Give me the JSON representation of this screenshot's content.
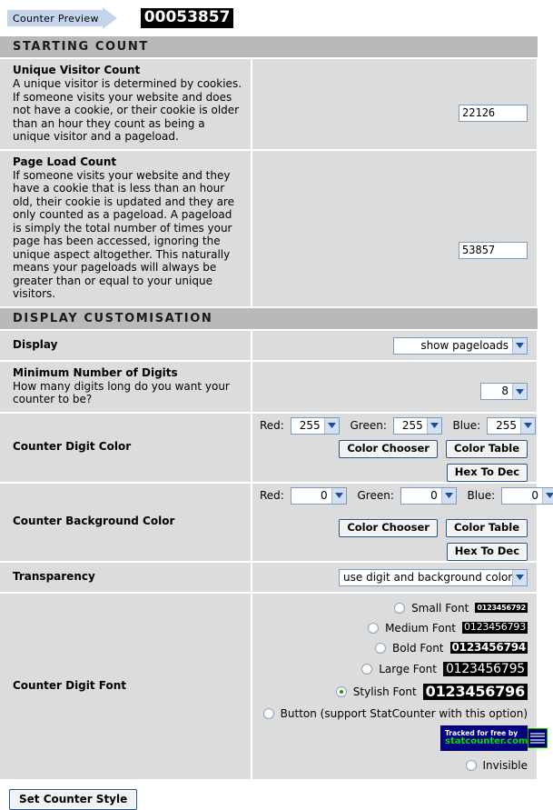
{
  "preview": {
    "label": "Counter Preview",
    "counter_value": "00053857"
  },
  "sections": {
    "starting_count": {
      "heading": "STARTING COUNT",
      "unique_visitor": {
        "title": "Unique Visitor Count",
        "description": "A unique visitor is determined by cookies. If someone visits your website and does not have a cookie, or their cookie is older than an hour they count as being a unique visitor and a pageload.",
        "value": "22126"
      },
      "page_load": {
        "title": "Page Load Count",
        "description": "If someone visits your website and they have a cookie that is less than an hour old, their cookie is updated and they are only counted as a pageload. A pageload is simply the total number of times your page has been accessed, ignoring the unique aspect altogether. This naturally means your pageloads will always be greater than or equal to your unique visitors.",
        "value": "53857"
      }
    },
    "display_customisation": {
      "heading": "DISPLAY CUSTOMISATION",
      "display": {
        "label": "Display",
        "selected": "show pageloads"
      },
      "min_digits": {
        "title": "Minimum Number of Digits",
        "description": "How many digits long do you want your counter to be?",
        "selected": "8"
      },
      "digit_color": {
        "label": "Counter Digit Color",
        "red_label": "Red:",
        "green_label": "Green:",
        "blue_label": "Blue:",
        "red": "255",
        "green": "255",
        "blue": "255",
        "btn_color_chooser": "Color Chooser",
        "btn_color_table": "Color Table",
        "btn_hex_to_dec": "Hex To Dec"
      },
      "background_color": {
        "label": "Counter Background Color",
        "red_label": "Red:",
        "green_label": "Green:",
        "blue_label": "Blue:",
        "red": "0",
        "green": "0",
        "blue": "0",
        "btn_color_chooser": "Color Chooser",
        "btn_color_table": "Color Table",
        "btn_hex_to_dec": "Hex To Dec"
      },
      "transparency": {
        "label": "Transparency",
        "selected": "use digit and background color"
      },
      "digit_font": {
        "label": "Counter Digit Font",
        "options": [
          {
            "label": "Small Font",
            "sample": "0123456792",
            "selected": false
          },
          {
            "label": "Medium Font",
            "sample": "0123456793",
            "selected": false
          },
          {
            "label": "Bold Font",
            "sample": "0123456794",
            "selected": false
          },
          {
            "label": "Large Font",
            "sample": "0123456795",
            "selected": false
          },
          {
            "label": "Stylish Font",
            "sample": "0123456796",
            "selected": true
          },
          {
            "label": "Button (support StatCounter with this option)",
            "sample": "",
            "selected": false
          },
          {
            "label": "Invisible",
            "sample": "",
            "selected": false
          }
        ],
        "badge": {
          "line1": "Tracked for free by",
          "line2": "statcounter.com"
        }
      }
    }
  },
  "footer": {
    "submit_label": "Set Counter Style"
  },
  "colors": {
    "section_header_bg": "#b9b9b9",
    "cell_bg": "#dcdcdc",
    "arrow_bg": "#c3d4ec",
    "radio_selected": "#1a8f1a",
    "badge_bg": "#000080",
    "badge_green": "#00e000"
  }
}
